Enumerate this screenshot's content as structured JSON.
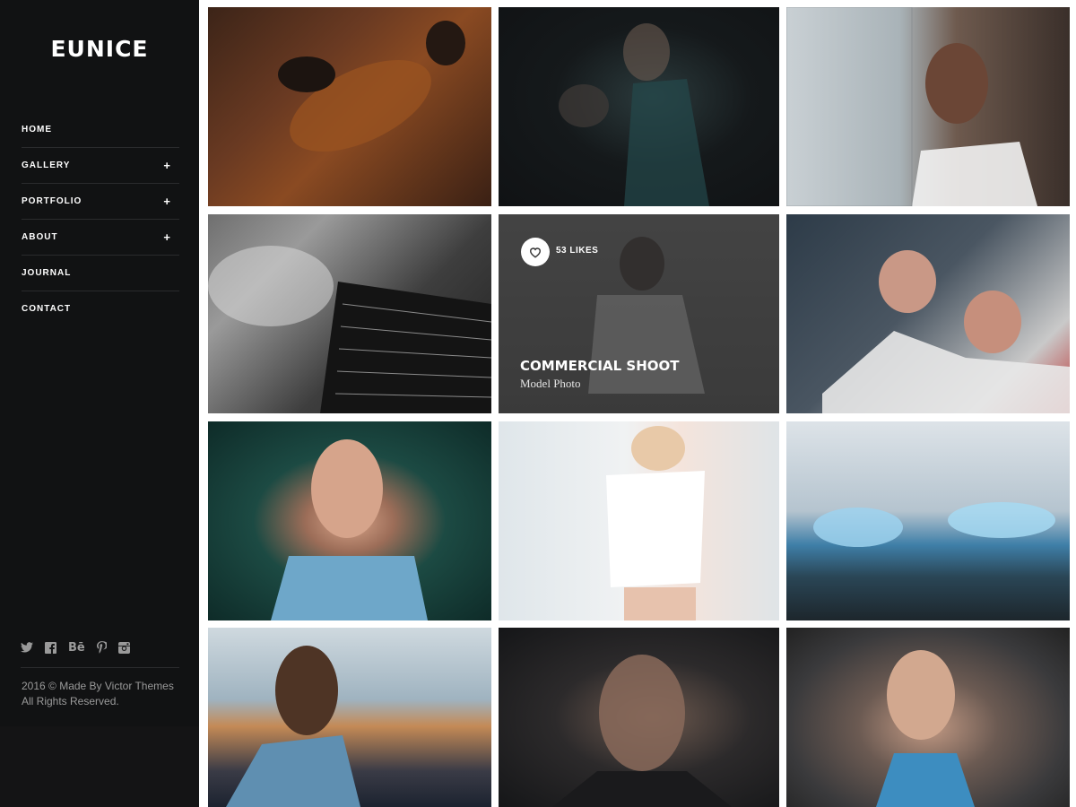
{
  "brand": {
    "logo": "EUNICE"
  },
  "nav": {
    "items": [
      {
        "label": "HOME",
        "expand": ""
      },
      {
        "label": "GALLERY",
        "expand": "+"
      },
      {
        "label": "PORTFOLIO",
        "expand": "+"
      },
      {
        "label": "ABOUT",
        "expand": "+"
      },
      {
        "label": "JOURNAL",
        "expand": ""
      },
      {
        "label": "CONTACT",
        "expand": ""
      }
    ]
  },
  "social": {
    "icons": [
      "twitter-icon",
      "facebook-icon",
      "behance-icon",
      "pinterest-icon",
      "instagram-icon"
    ],
    "behance_label": "Bē"
  },
  "footer": {
    "line1": "2016 © Made By Victor Themes",
    "line2": "All Rights Reserved."
  },
  "gallery": {
    "featured": {
      "likes": "53 LIKES",
      "title": "COMMERCIAL SHOOT",
      "subtitle": "Model Photo"
    }
  },
  "colors": {
    "sidebar_bg": "#111213",
    "divider": "#2a2b2d",
    "text_primary": "#ffffff",
    "text_muted": "#9a9a9a"
  }
}
